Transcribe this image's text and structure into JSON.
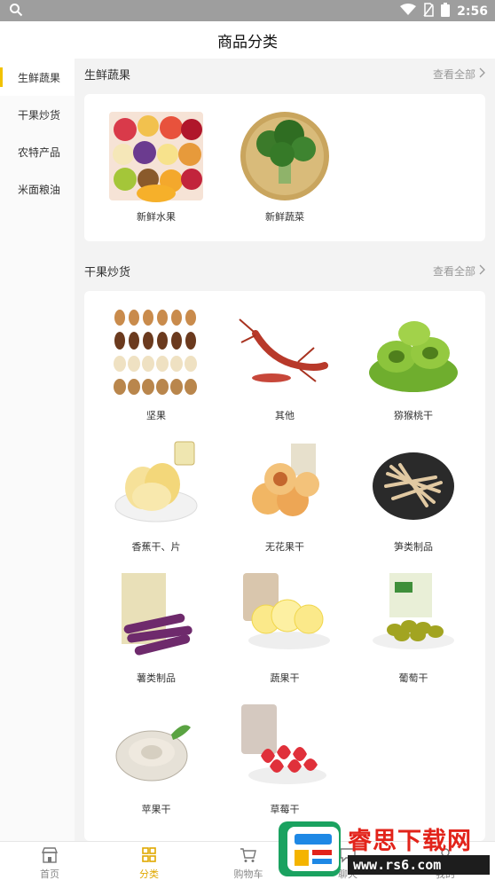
{
  "status": {
    "time": "2:56"
  },
  "header": {
    "title": "商品分类"
  },
  "sidebar": {
    "items": [
      {
        "label": "生鲜蔬果",
        "active": true
      },
      {
        "label": "干果炒货",
        "active": false
      },
      {
        "label": "农特产品",
        "active": false
      },
      {
        "label": "米面粮油",
        "active": false
      }
    ]
  },
  "sections": [
    {
      "title": "生鲜蔬果",
      "view_all": "查看全部",
      "items": [
        {
          "label": "新鲜水果",
          "icon": "fruit-platter-image"
        },
        {
          "label": "新鲜蔬菜",
          "icon": "broccoli-image"
        }
      ]
    },
    {
      "title": "干果炒货",
      "view_all": "查看全部",
      "items": [
        {
          "label": "坚果",
          "icon": "mixed-nuts-image"
        },
        {
          "label": "其他",
          "icon": "crayfish-image"
        },
        {
          "label": "猕猴桃干",
          "icon": "dried-kiwi-image"
        },
        {
          "label": "香蕉干、片",
          "icon": "banana-chips-image"
        },
        {
          "label": "无花果干",
          "icon": "dried-figs-image"
        },
        {
          "label": "笋类制品",
          "icon": "bamboo-shoots-image"
        },
        {
          "label": "薯类制品",
          "icon": "sweet-potato-image"
        },
        {
          "label": "蔬果干",
          "icon": "dried-fruit-slices-image"
        },
        {
          "label": "葡萄干",
          "icon": "raisins-image"
        },
        {
          "label": "苹果干",
          "icon": "oyster-image"
        },
        {
          "label": "草莓干",
          "icon": "dried-strawberry-image"
        }
      ]
    }
  ],
  "tabbar": {
    "items": [
      {
        "label": "首页",
        "icon": "store-icon"
      },
      {
        "label": "分类",
        "icon": "grid-icon"
      },
      {
        "label": "购物车",
        "icon": "cart-icon"
      },
      {
        "label": "聊天",
        "icon": "chat-icon"
      },
      {
        "label": "我的",
        "icon": "user-icon"
      }
    ]
  },
  "watermark": {
    "text": "睿思下载网",
    "url": "www.rs6.com"
  },
  "colors": {
    "accent": "#e0a800",
    "active_bar": "#f2c200",
    "watermark_red": "#e2231a"
  }
}
